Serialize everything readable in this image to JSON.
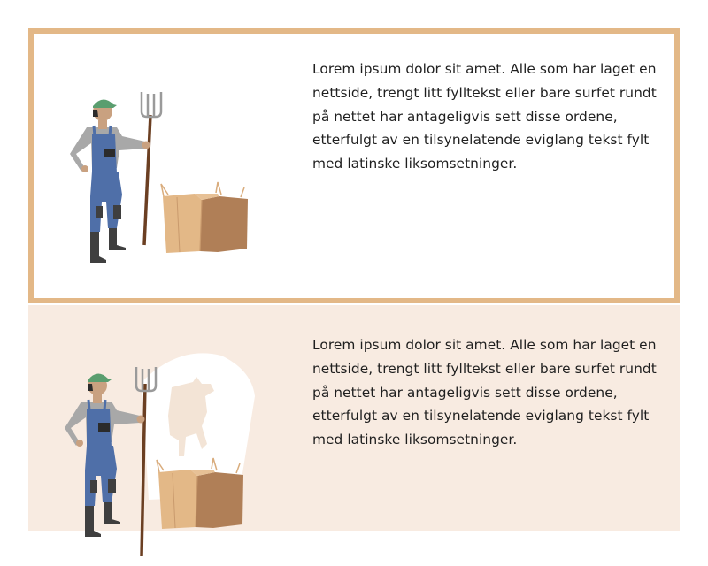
{
  "cards": [
    {
      "variant": "selected",
      "illustration": "farmer-with-pitchfork-and-hay-bale",
      "paragraph": "Lorem ipsum dolor sit amet. Alle som har laget en nettside, trengt litt fylltekst eller bare surfet rundt på nettet har antageligvis sett disse ordene, etterfulgt av en tilsynelatende eviglang tekst fylt med latinske liksomsetninger."
    },
    {
      "variant": "tinted",
      "illustration": "farmer-with-pitchfork-hay-bale-and-cow-silhouette",
      "paragraph": "Lorem ipsum dolor sit amet. Alle som har laget en nettside, trengt litt fylltekst eller bare surfet rundt på nettet har antageligvis sett disse ordene, etterfulgt av en tilsynelatende eviglang tekst fylt med latinske liksomsetninger."
    }
  ],
  "colors": {
    "card_border": "#e3b887",
    "card_tint": "#f8ebe1",
    "overalls": "#4f6fa8",
    "cap": "#5a9e6f",
    "hay_light": "#e3b887",
    "hay_dark": "#b07f57"
  }
}
